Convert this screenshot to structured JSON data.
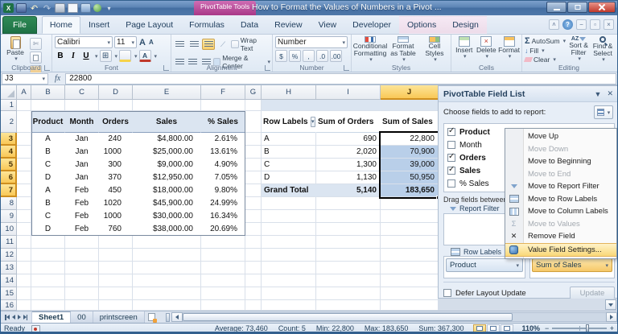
{
  "window": {
    "title": "How to Format the Values of Numbers in a Pivot ...",
    "tools_tab": "PivotTable Tools"
  },
  "qat": {
    "icons": [
      "excel",
      "save",
      "undo",
      "redo",
      "print",
      "preview",
      "macros",
      "web",
      "more"
    ]
  },
  "tabs": {
    "items": [
      "File",
      "Home",
      "Insert",
      "Page Layout",
      "Formulas",
      "Data",
      "Review",
      "View",
      "Developer",
      "Options",
      "Design"
    ],
    "active": "Home",
    "contextual": [
      "Options",
      "Design"
    ]
  },
  "ribbon": {
    "clipboard": {
      "label": "Clipboard",
      "paste": "Paste"
    },
    "font": {
      "label": "Font",
      "family": "Calibri",
      "size": "11",
      "bold": "B",
      "italic": "I",
      "underline": "U",
      "grow": "A",
      "shrink": "A",
      "color_a": "A"
    },
    "alignment": {
      "label": "Alignment",
      "wrap": "Wrap Text",
      "merge": "Merge & Center"
    },
    "number": {
      "label": "Number",
      "format": "Number",
      "mini": [
        "$",
        "%",
        ",",
        ".0",
        ".00"
      ]
    },
    "styles": {
      "label": "Styles",
      "conditional": "Conditional Formatting",
      "format_table": "Format as Table",
      "cell_styles": "Cell Styles"
    },
    "cells": {
      "label": "Cells",
      "insert": "Insert",
      "delete": "Delete",
      "format": "Format"
    },
    "editing": {
      "label": "Editing",
      "sigma": "Σ",
      "autosum": "AutoSum",
      "fill": "Fill",
      "clear": "Clear",
      "sort": "Sort & Filter",
      "find": "Find & Select",
      "az": "AZ"
    }
  },
  "formula_bar": {
    "name_box": "J3",
    "fx_label": "fx",
    "value": "22800"
  },
  "sheet": {
    "columns": [
      "A",
      "B",
      "C",
      "D",
      "E",
      "F",
      "G",
      "H",
      "I",
      "J"
    ],
    "rows_visible": 16,
    "selected_column": "J",
    "selected_rows": [
      3,
      4,
      5,
      6,
      7
    ],
    "data_table": {
      "headers": [
        "Product",
        "Month",
        "Orders",
        "Sales",
        "% Sales"
      ],
      "rows": [
        [
          "A",
          "Jan",
          "240",
          "$4,800.00",
          "2.61%"
        ],
        [
          "B",
          "Jan",
          "1000",
          "$25,000.00",
          "13.61%"
        ],
        [
          "C",
          "Jan",
          "300",
          "$9,000.00",
          "4.90%"
        ],
        [
          "D",
          "Jan",
          "370",
          "$12,950.00",
          "7.05%"
        ],
        [
          "A",
          "Feb",
          "450",
          "$18,000.00",
          "9.80%"
        ],
        [
          "B",
          "Feb",
          "1020",
          "$45,900.00",
          "24.99%"
        ],
        [
          "C",
          "Feb",
          "1000",
          "$30,000.00",
          "16.34%"
        ],
        [
          "D",
          "Feb",
          "760",
          "$38,000.00",
          "20.69%"
        ]
      ]
    },
    "pivot_table": {
      "headers": [
        "Row Labels",
        "Sum of Orders",
        "Sum of Sales"
      ],
      "rows": [
        [
          "A",
          "690",
          "22,800"
        ],
        [
          "B",
          "2,020",
          "70,900"
        ],
        [
          "C",
          "1,300",
          "39,000"
        ],
        [
          "D",
          "1,130",
          "50,950"
        ]
      ],
      "grand_total": [
        "Grand Total",
        "5,140",
        "183,650"
      ]
    }
  },
  "field_list": {
    "title": "PivotTable Field List",
    "choose_label": "Choose fields to add to report:",
    "fields": [
      {
        "name": "Product",
        "checked": true
      },
      {
        "name": "Month",
        "checked": false
      },
      {
        "name": "Orders",
        "checked": true
      },
      {
        "name": "Sales",
        "checked": true
      },
      {
        "name": "% Sales",
        "checked": false
      }
    ],
    "drag_label": "Drag fields between areas below:",
    "areas": {
      "report_filter": "Report Filter",
      "row_labels": "Row Labels",
      "row_field": "Product",
      "values_field": "Sum of Sales"
    },
    "defer_label": "Defer Layout Update",
    "update_label": "Update"
  },
  "context_menu": {
    "items": [
      {
        "label": "Move Up",
        "icon": "none",
        "enabled": true,
        "highlighted": false
      },
      {
        "label": "Move Down",
        "icon": "none",
        "enabled": false,
        "highlighted": false
      },
      {
        "label": "Move to Beginning",
        "icon": "none",
        "enabled": true,
        "highlighted": false
      },
      {
        "label": "Move to End",
        "icon": "none",
        "enabled": false,
        "highlighted": false
      },
      {
        "label": "Move to Report Filter",
        "icon": "filter",
        "enabled": true,
        "highlighted": false
      },
      {
        "label": "Move to Row Labels",
        "icon": "rows",
        "enabled": true,
        "highlighted": false
      },
      {
        "label": "Move to Column Labels",
        "icon": "cols",
        "enabled": true,
        "highlighted": false
      },
      {
        "label": "Move to Values",
        "icon": "sigma",
        "glyph": "Σ",
        "enabled": false,
        "highlighted": false
      },
      {
        "label": "Remove Field",
        "icon": "remove",
        "glyph": "✕",
        "enabled": true,
        "highlighted": false
      },
      {
        "label": "Value Field Settings...",
        "icon": "settings",
        "enabled": true,
        "highlighted": true
      }
    ]
  },
  "sheet_tabs": {
    "tabs": [
      "Sheet1",
      "00",
      "printscreen"
    ],
    "active": "Sheet1"
  },
  "status_bar": {
    "mode": "Ready",
    "stats": [
      {
        "label": "Average:",
        "value": "73,460"
      },
      {
        "label": "Count:",
        "value": "5"
      },
      {
        "label": "Min:",
        "value": "22,800"
      },
      {
        "label": "Max:",
        "value": "183,650"
      },
      {
        "label": "Sum:",
        "value": "367,300"
      }
    ],
    "zoom": "110%"
  }
}
